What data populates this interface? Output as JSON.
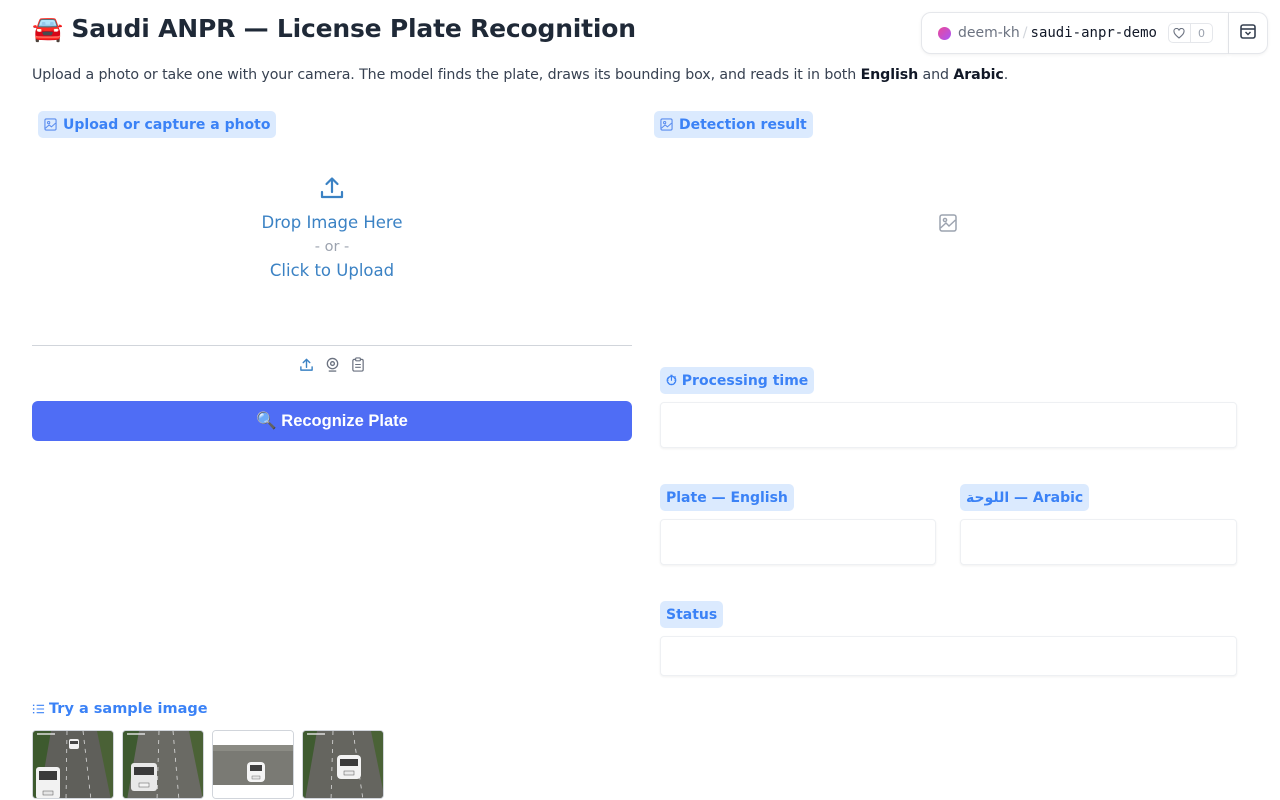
{
  "header": {
    "title": "🚘 Saudi ANPR — License Plate Recognition",
    "subtitle_pre": "Upload a photo or take one with your camera. The model finds the plate, draws its bounding box, and reads it in both ",
    "subtitle_b1": "English",
    "subtitle_mid": " and ",
    "subtitle_b2": "Arabic",
    "subtitle_end": "."
  },
  "space": {
    "owner": "deem-kh",
    "separator": "/",
    "name": "saudi-anpr-demo",
    "likes": "0",
    "icons": [
      "heart-icon",
      "menu-icon"
    ]
  },
  "input": {
    "label": "Upload or capture a photo",
    "drop_text": "Drop Image Here",
    "or_text": "- or -",
    "click_text": "Click to Upload",
    "sources": [
      "upload-icon",
      "webcam-icon",
      "clipboard-icon"
    ]
  },
  "button": {
    "recognize": "🔍 Recognize Plate"
  },
  "output": {
    "detection_label": "Detection result",
    "processing_label": "⏱ Processing time",
    "processing_value": "",
    "plate_en_label": "Plate — English",
    "plate_en_value": "",
    "plate_ar_label": "اللوحة — Arabic",
    "plate_ar_value": "",
    "status_label": "Status",
    "status_value": ""
  },
  "samples": {
    "label": "Try a sample image",
    "count": 4
  },
  "colors": {
    "accent": "#4f6df5",
    "label_bg": "#dbeafe",
    "label_text": "#3b82f6"
  }
}
